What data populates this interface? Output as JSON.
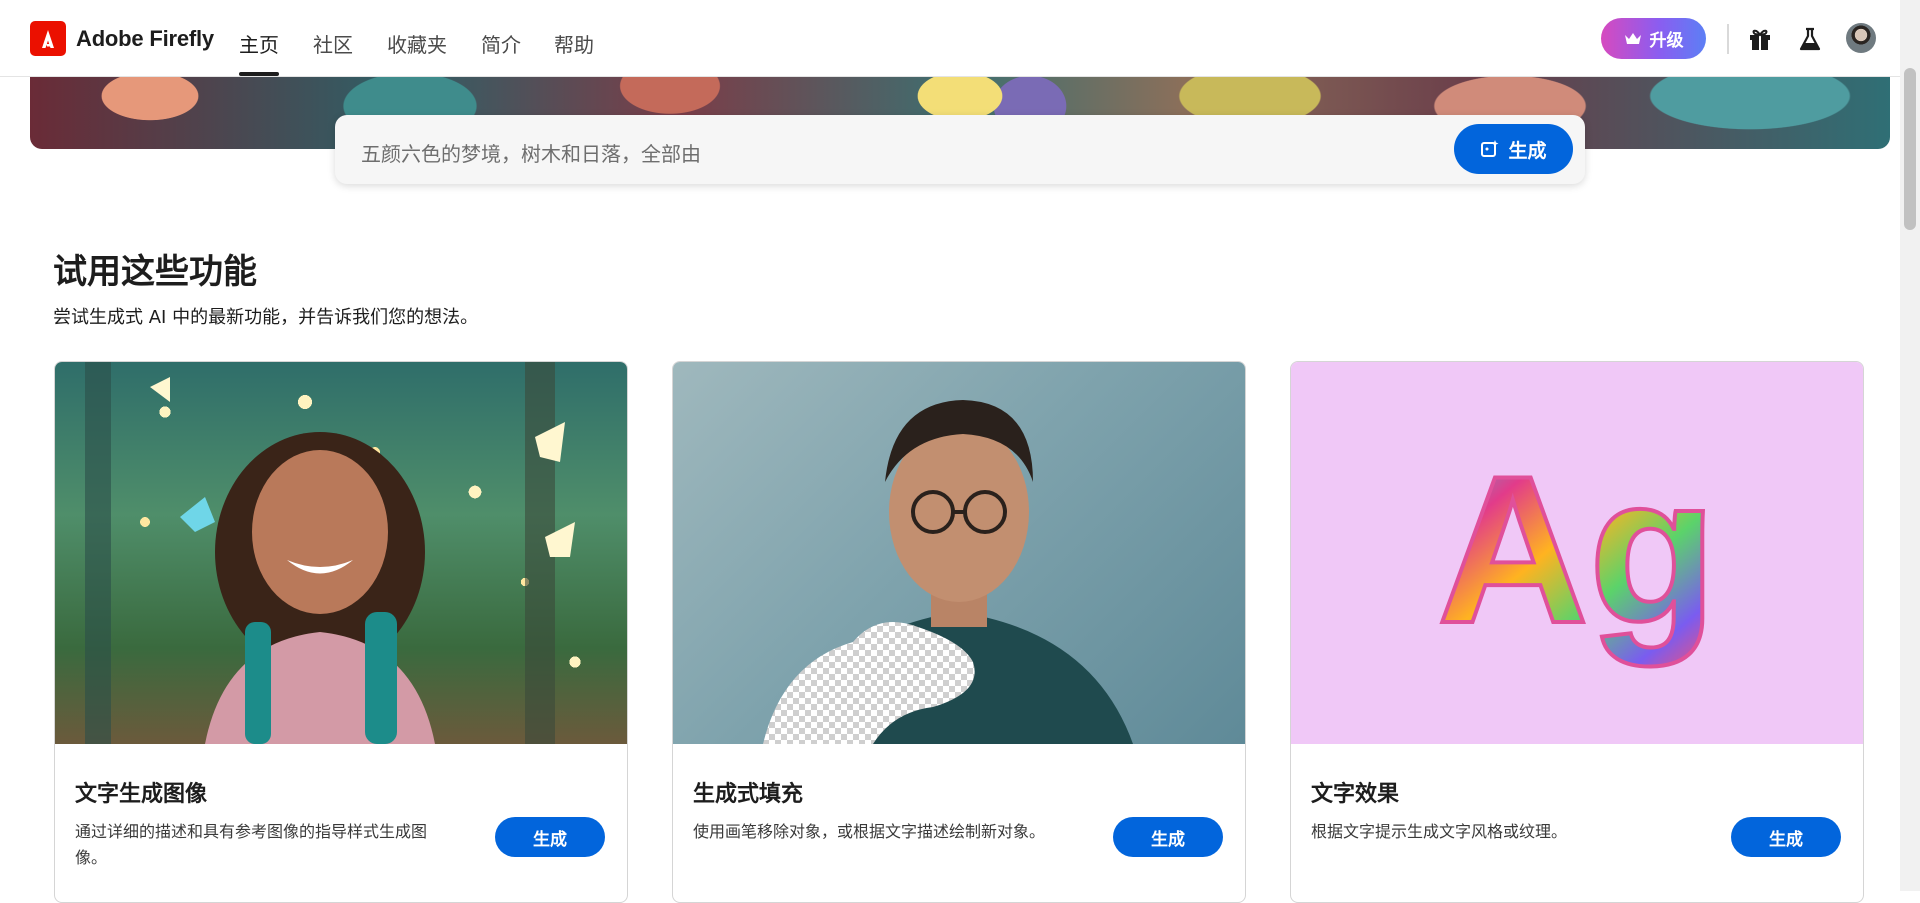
{
  "header": {
    "brand": "Adobe Firefly",
    "nav": [
      {
        "label": "主页"
      },
      {
        "label": "社区"
      },
      {
        "label": "收藏夹"
      },
      {
        "label": "简介"
      },
      {
        "label": "帮助"
      }
    ],
    "active_nav": "主页",
    "upgrade_label": "升级",
    "icons": [
      "gift-icon",
      "flask-icon",
      "user-avatar"
    ]
  },
  "prompt": {
    "text": "五颜六色的梦境，树木和日落，全部由",
    "generate_label": "生成"
  },
  "section": {
    "title": "试用这些功能",
    "description": "尝试生成式 AI 中的最新功能，并告诉我们您的想法。"
  },
  "cards": [
    {
      "title": "文字生成图像",
      "description": "通过详细的描述和具有参考图像的指导样式生成图像。",
      "button": "生成"
    },
    {
      "title": "生成式填充",
      "description": "使用画笔移除对象，或根据文字描述绘制新对象。",
      "button": "生成"
    },
    {
      "title": "文字效果",
      "description": "根据文字提示生成文字风格或纹理。",
      "button": "生成",
      "image_text": "Ag"
    }
  ],
  "colors": {
    "primary": "#0265dc",
    "brand": "#eb1000",
    "upgrade_gradient": [
      "#d64abf",
      "#5c7ff5"
    ]
  }
}
